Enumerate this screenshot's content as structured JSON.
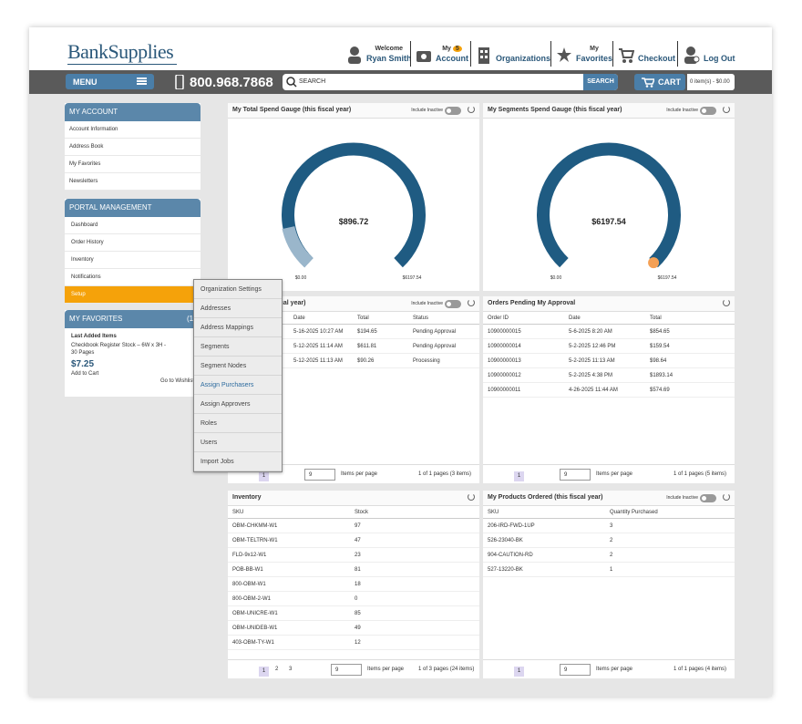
{
  "header": {
    "logo": "BankSupplies",
    "welcome": "Welcome",
    "user": "Ryan Smith",
    "my": "My",
    "account": "Account",
    "cart_count": "5",
    "organizations": "Organizations",
    "favorites": "Favorites",
    "checkout": "Checkout",
    "logout": "Log Out"
  },
  "navbar": {
    "menu": "MENU",
    "phone": "800.968.7868",
    "search_placeholder": "SEARCH",
    "search_btn": "SEARCH",
    "cart": "CART",
    "cart_info": "0 item(s) - $0.00"
  },
  "my_account": {
    "title": "MY ACCOUNT",
    "items": [
      "Account Information",
      "Address Book",
      "My Favorites",
      "Newsletters"
    ]
  },
  "portal": {
    "title": "PORTAL MANAGEMENT",
    "items": [
      "Dashboard",
      "Order History",
      "Inventory",
      "Notifications",
      "Setup"
    ]
  },
  "favorites": {
    "title": "MY FAVORITES",
    "count": "(1",
    "last": "Last Added Items",
    "product": "Checkbook Register Stock – 6W x 3H - 30 Pages",
    "price": "$7.25",
    "add": "Add to Cart",
    "wishlist": "Go to Wishlist"
  },
  "dropdown": [
    "Organization Settings",
    "Addresses",
    "Address Mappings",
    "Segments",
    "Segment Nodes",
    "Assign Purchasers",
    "Assign Approvers",
    "Roles",
    "Users",
    "Import Jobs"
  ],
  "gauge1": {
    "title": "My Total Spend Gauge (this fiscal year)",
    "value": "$896.72",
    "min": "$0.00",
    "max": "$6197.54",
    "inc": "Include Inactive"
  },
  "gauge2": {
    "title": "My Segments Spend Gauge (this fiscal year)",
    "value": "$6197.54",
    "min": "$0.00",
    "max": "$6197.54",
    "inc": "Include Inactive"
  },
  "orders": {
    "title": "cal year)",
    "inc": "Include Inactive",
    "cols": [
      "Date",
      "Total",
      "Status"
    ],
    "rows": [
      [
        "5-16-2025 10:27 AM",
        "$194.65",
        "Pending Approval"
      ],
      [
        "5-12-2025 11:14 AM",
        "$611.81",
        "Pending Approval"
      ],
      [
        "5-12-2025 11:13 AM",
        "$90.26",
        "Processing"
      ]
    ],
    "page": "1",
    "size": "9",
    "per": "Items per page",
    "info": "1 of 1 pages (3 items)"
  },
  "pending": {
    "title": "Orders Pending My Approval",
    "cols": [
      "Order ID",
      "Date",
      "Total"
    ],
    "rows": [
      [
        "10900000015",
        "5-6-2025 8:20 AM",
        "$854.65"
      ],
      [
        "10900000014",
        "5-2-2025 12:46 PM",
        "$159.54"
      ],
      [
        "10900000013",
        "5-2-2025 11:13 AM",
        "$98.64"
      ],
      [
        "10900000012",
        "5-2-2025 4:38 PM",
        "$1893.14"
      ],
      [
        "10900000011",
        "4-26-2025 11:44 AM",
        "$574.69"
      ]
    ],
    "page": "1",
    "size": "9",
    "per": "Items per page",
    "info": "1 of 1 pages (5 items)"
  },
  "inventory": {
    "title": "Inventory",
    "cols": [
      "SKU",
      "Stock"
    ],
    "rows": [
      [
        "OBM-CHKMM-W1",
        "97"
      ],
      [
        "OBM-TELTRN-W1",
        "47"
      ],
      [
        "FLD-9x12-W1",
        "23"
      ],
      [
        "POB-BB-W1",
        "81"
      ],
      [
        "800-OBM-W1",
        "18"
      ],
      [
        "800-OBM-2-W1",
        "0"
      ],
      [
        "OBM-UNICRE-W1",
        "85"
      ],
      [
        "OBM-UNIDEB-W1",
        "49"
      ],
      [
        "403-OBM-TY-W1",
        "12"
      ]
    ],
    "pages": [
      "1",
      "2",
      "3"
    ],
    "size": "9",
    "per": "Items per page",
    "info": "1 of 3 pages (24 items)"
  },
  "products": {
    "title": "My Products Ordered (this fiscal year)",
    "inc": "Include Inactive",
    "cols": [
      "SKU",
      "Quantity Purchased"
    ],
    "rows": [
      [
        "206-IRD-FWD-1UP",
        "3"
      ],
      [
        "526-23040-BK",
        "2"
      ],
      [
        "904-CAUTION-RD",
        "2"
      ],
      [
        "527-13220-BK",
        "1"
      ]
    ],
    "page": "1",
    "size": "9",
    "per": "Items per page",
    "info": "1 of 1 pages (4 items)"
  },
  "colors": {
    "gauge": "#1f5b82",
    "accent": "#f5a20a",
    "header": "#5b87aa"
  }
}
